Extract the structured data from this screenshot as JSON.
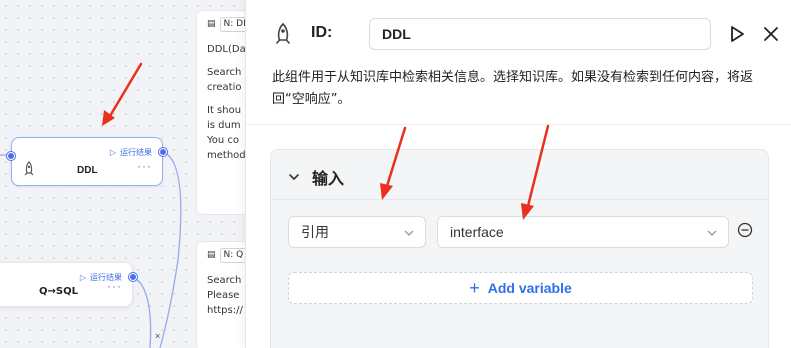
{
  "canvas": {
    "nodes": [
      {
        "id": "ddl",
        "label": "DDL",
        "status": "运行结果",
        "more": "···"
      },
      {
        "id": "qsql",
        "label": "Q→SQL",
        "status": "运行结果",
        "more": "···"
      }
    ],
    "notes": [
      {
        "tag": "N: DD",
        "lines": [
          "DDL(Da",
          "",
          "Search",
          "creatio",
          "",
          "It shou",
          "is dum",
          "You co",
          "method"
        ]
      },
      {
        "tag": "N: Q",
        "lines": [
          "Search",
          "Please",
          "https://"
        ]
      }
    ],
    "edge_mark": "×"
  },
  "panel": {
    "id_label": "ID:",
    "id_value": "DDL",
    "icons": {
      "component": "rocket-icon",
      "run": "play-icon",
      "close": "close-icon"
    },
    "description": "此组件用于从知识库中检索相关信息。选择知识库。如果没有检索到任何内容，将返回“空响应”。",
    "input_section": {
      "title": "输入",
      "reference_select": "引用",
      "variable_select": "interface",
      "add_variable_label": "Add variable"
    }
  },
  "colors": {
    "accent": "#2f6fe8",
    "annotation_arrow": "#e8301c",
    "selected_border": "#8fb2f7"
  }
}
